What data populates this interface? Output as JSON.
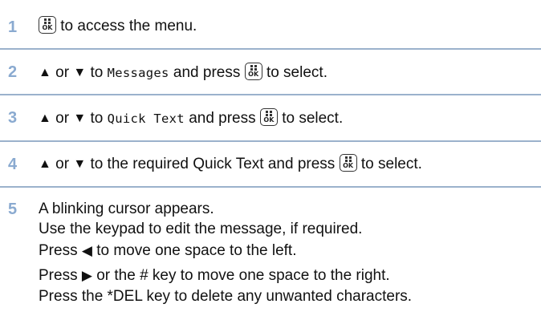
{
  "steps": [
    {
      "number": "1",
      "text_after_key": "to access the menu."
    },
    {
      "number": "2",
      "or": "or",
      "to": "to",
      "menu_item": "Messages",
      "and_press": "and press",
      "to_select": "to select."
    },
    {
      "number": "3",
      "or": "or",
      "to": "to",
      "menu_item": "Quick Text",
      "and_press": "and press",
      "to_select": "to select."
    },
    {
      "number": "4",
      "or": "or",
      "to_text": "to the required Quick Text and press",
      "to_select": "to select."
    },
    {
      "number": "5",
      "line1": "A blinking cursor appears.",
      "line2": "Use the keypad to edit the message, if required.",
      "line3_pre": "Press",
      "line3_post": "to move one space to the left.",
      "line4_pre": "Press",
      "line4_post": "or the # key to move one space to the right.",
      "line5": "Press the *DEL key to delete any unwanted characters."
    }
  ],
  "ok_key": {
    "label": "OK",
    "icon": "menu-ok-key-icon"
  },
  "colors": {
    "step_number": "#8aaad0",
    "rule": "#9bb2cc",
    "text": "#111111"
  }
}
